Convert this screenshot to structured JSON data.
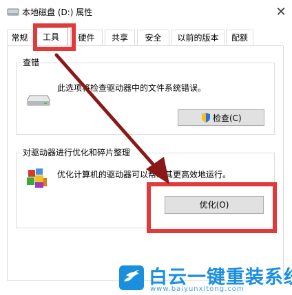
{
  "window": {
    "title": "本地磁盘 (D:) 属性",
    "close_label": "✕"
  },
  "tabs": [
    {
      "label": "常规"
    },
    {
      "label": "工具",
      "active": true
    },
    {
      "label": "硬件"
    },
    {
      "label": "共享"
    },
    {
      "label": "安全"
    },
    {
      "label": "以前的版本"
    },
    {
      "label": "配额"
    }
  ],
  "error_check": {
    "title": "查错",
    "description": "此选项将检查驱动器中的文件系统错误。",
    "check_button": "检查(C)",
    "drive_icon": "hard-drive-icon",
    "shield_icon": "uac-shield-icon"
  },
  "optimize": {
    "title": "对驱动器进行优化和碎片整理",
    "description": "优化计算机的驱动器可以帮助其更高效地运行。",
    "optimize_button": "优化(O)",
    "defrag_icon": "defrag-blocks-icon"
  },
  "watermark": {
    "brand": "白云一键重装系统",
    "url": "www.baiyunxitong.com",
    "logo_icon": "bird-logo-icon"
  },
  "colors": {
    "highlight_red": "#e03a3a",
    "arrow": "#8a1818",
    "watermark_blue": "#1a8fdd"
  }
}
